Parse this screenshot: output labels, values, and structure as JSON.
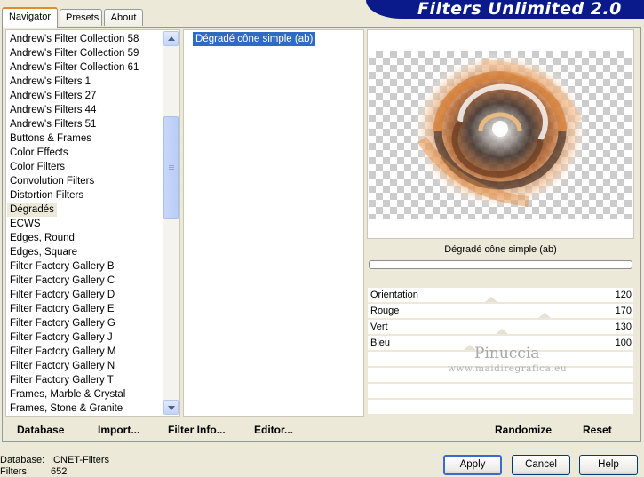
{
  "header": {
    "banner_title": "Filters Unlimited 2.0"
  },
  "tabs": [
    {
      "label": "Navigator",
      "active": true
    },
    {
      "label": "Presets",
      "active": false
    },
    {
      "label": "About",
      "active": false
    }
  ],
  "categories": [
    "Andrew's Filter Collection 58",
    "Andrew's Filter Collection 59",
    "Andrew's Filter Collection 61",
    "Andrew's Filters 1",
    "Andrew's Filters 27",
    "Andrew's Filters 44",
    "Andrew's Filters 51",
    "Buttons & Frames",
    "Color Effects",
    "Color Filters",
    "Convolution Filters",
    "Distortion Filters",
    "Dégradés",
    "ECWS",
    "Edges, Round",
    "Edges, Square",
    "Filter Factory Gallery B",
    "Filter Factory Gallery C",
    "Filter Factory Gallery D",
    "Filter Factory Gallery E",
    "Filter Factory Gallery G",
    "Filter Factory Gallery J",
    "Filter Factory Gallery M",
    "Filter Factory Gallery N",
    "Filter Factory Gallery T",
    "Frames, Marble & Crystal",
    "Frames, Stone & Granite"
  ],
  "selected_category": "Dégradés",
  "filters": [
    "Dégradé cône simple (ab)"
  ],
  "toolbar": {
    "database": "Database",
    "import": "Import...",
    "filter_info": "Filter Info...",
    "editor": "Editor...",
    "randomize": "Randomize",
    "reset": "Reset"
  },
  "filter_name": "Dégradé cône simple (ab)",
  "params": [
    {
      "name": "Orientation",
      "value": "120"
    },
    {
      "name": "Rouge",
      "value": "170"
    },
    {
      "name": "Vert",
      "value": "130"
    },
    {
      "name": "Bleu",
      "value": "100"
    }
  ],
  "watermark": {
    "name": "Pinuccia",
    "url": "www.maidiregrafica.eu"
  },
  "status": {
    "database_label": "Database:",
    "database_value": "ICNET-Filters",
    "filters_label": "Filters:",
    "filters_value": "652"
  },
  "buttons": {
    "apply": "Apply",
    "cancel": "Cancel",
    "help": "Help"
  }
}
